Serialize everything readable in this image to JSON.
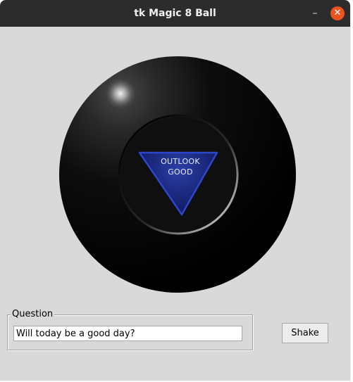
{
  "window": {
    "title": "tk Magic 8 Ball",
    "minimize_glyph": "–",
    "close_glyph": "✕"
  },
  "ball": {
    "answer_line1": "OUTLOOK",
    "answer_line2": "GOOD",
    "colors": {
      "ball": "#000000",
      "window_inner": "#111111",
      "triangle": "#1e2e8a",
      "triangle_edge": "#2a44c6",
      "text": "#e8ecff"
    }
  },
  "question": {
    "legend": "Question",
    "value": "Will today be a good day?"
  },
  "actions": {
    "shake_label": "Shake"
  },
  "colors": {
    "titlebar": "#2c2c2c",
    "close_button": "#e9541f",
    "window_bg": "#d9d9d9"
  }
}
